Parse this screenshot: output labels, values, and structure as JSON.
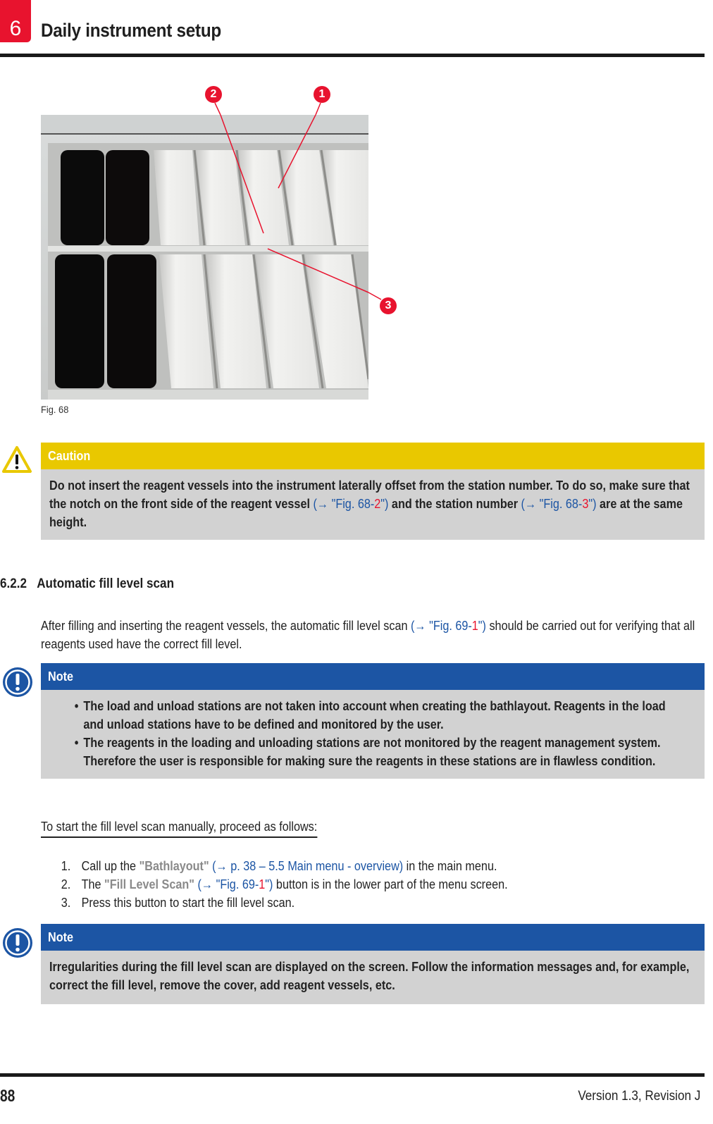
{
  "header": {
    "chapter_number": "6",
    "chapter_title": "Daily instrument setup"
  },
  "figure": {
    "caption": "Fig. 68",
    "callouts": [
      "1",
      "2",
      "3"
    ],
    "description": "Reagent vessels inserted in instrument drawer: two rows of stations, two black vessels on the left, white vessels on the right"
  },
  "caution": {
    "label": "Caution",
    "icon": "warning-triangle-icon",
    "text_1": "Do not insert the reagent vessels into the instrument laterally offset from the station number. To do so, make sure that the notch on the front side of the reagent vessel",
    "ref_1_prefix": "(→ \"Fig. 68-",
    "ref_1_num": "2",
    "ref_1_suffix": "\")",
    "text_2": "and the station number",
    "ref_2_prefix": "(→ \"Fig. 68-",
    "ref_2_num": "3",
    "ref_2_suffix": "\")",
    "text_3": "are at the same height."
  },
  "section": {
    "number": "6.2.2",
    "title": "Automatic fill level scan"
  },
  "intro": {
    "text_1": "After filling and inserting the reagent vessels, the automatic fill level scan",
    "ref_prefix": "(→ \"Fig. 69-",
    "ref_num": "1",
    "ref_suffix": "\")",
    "text_2": "should be carried out for verifying that all reagents used have the correct fill level."
  },
  "note_1": {
    "label": "Note",
    "icon": "info-exclamation-icon",
    "bullets": [
      "The load and unload stations are not taken into account when creating the bathlayout. Reagents in the load and unload stations have to be defined and monitored by the user.",
      "The reagents in the loading and unloading stations are not monitored by the reagent management system. Therefore the user is responsible for making sure the reagents in these stations are in flawless condition."
    ]
  },
  "procedure": {
    "lead": "To start the fill level scan manually, proceed as follows:",
    "steps": [
      {
        "n": "1.",
        "pre": "Call up the",
        "term": "\"Bathlayout\"",
        "ref": "(→ p. 38 – 5.5 Main menu - overview)",
        "post": "in the main menu."
      },
      {
        "n": "2.",
        "pre": "The",
        "term": "\"Fill Level Scan\"",
        "ref_prefix": "(→ \"Fig. 69-",
        "ref_num": "1",
        "ref_suffix": "\")",
        "post": "button is in the lower part of the menu screen."
      },
      {
        "n": "3.",
        "text": "Press this button to start the fill level scan."
      }
    ]
  },
  "note_2": {
    "label": "Note",
    "icon": "info-exclamation-icon",
    "text": "Irregularities during the fill level scan are displayed on the screen. Follow the information messages and, for example, correct the fill level, remove the cover, add reagent vessels, etc."
  },
  "footer": {
    "page_number": "88",
    "version": "Version 1.3, Revision J"
  },
  "colors": {
    "accent_red": "#e8132e",
    "caution_yellow": "#e9c800",
    "note_blue": "#1c55a4",
    "box_gray": "#d2d2d2",
    "ui_term_gray": "#8a8a8a"
  }
}
